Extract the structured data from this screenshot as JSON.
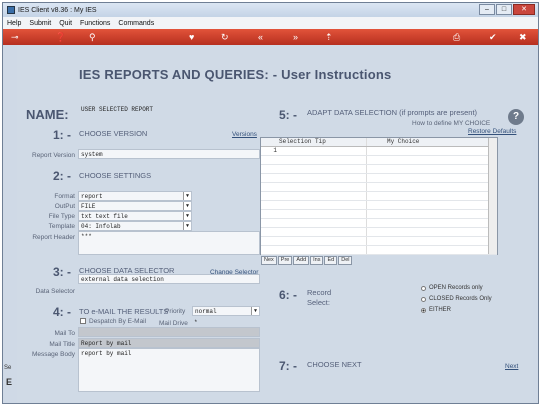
{
  "window": {
    "title": "IES Client v8.36 : My IES",
    "controls": [
      "–",
      "□",
      "✕"
    ]
  },
  "menu": {
    "items": [
      "Help",
      "Submit",
      "Quit",
      "Functions",
      "Commands"
    ]
  },
  "toolbar": {
    "icons": [
      "key-icon",
      "help-icon",
      "search-icon",
      "heart-icon",
      "refresh-icon",
      "first-icon",
      "last-icon",
      "up-icon",
      "print-icon",
      "accept-icon",
      "cancel-icon"
    ]
  },
  "page": {
    "heading": "IES REPORTS AND QUERIES: -   User Instructions",
    "name_label": "NAME:",
    "name_value": "USER SELECTED REPORT",
    "sections": {
      "s1": {
        "num": "1: -",
        "title": "CHOOSE VERSION",
        "link": "Versions",
        "report_version_label": "Report Version",
        "report_version_value": "system"
      },
      "s2": {
        "num": "2: -",
        "title": "CHOOSE SETTINGS",
        "format_label": "Format",
        "format_value": "report",
        "output_label": "OutPut",
        "output_value": "FILE",
        "filetype_label": "File Type",
        "filetype_value": "txt text file",
        "template_label": "Template",
        "template_value": "04: Infolab",
        "header_label": "Report Header",
        "header_value": "***"
      },
      "s3": {
        "num": "3: -",
        "title": "CHOOSE DATA SELECTOR",
        "link": "Change Selector",
        "selector_value": "external data selection",
        "data_selector_label": "Data Selector"
      },
      "s4": {
        "num": "4: -",
        "title": "TO e-MAIL THE RESULTS",
        "priority_label": "Priority",
        "priority_value": "normal",
        "despatch_label": "Despatch By E-Mail",
        "mail_drive_label": "Mail Drive",
        "mail_drive_value": "*",
        "mail_to_label": "Mail To",
        "mail_title_label": "Mail Title",
        "mail_title_value": "Report by mail",
        "mail_body_label": "Message Body",
        "mail_body_value": "report by mail"
      },
      "s5": {
        "num": "5: -",
        "title": "ADAPT DATA SELECTION (if prompts are present)",
        "howto": "How to define MY CHOICE",
        "restore": "Restore Defaults",
        "columns": [
          "Selection Tip",
          "My Choice"
        ],
        "row_number": "1",
        "grid_buttons": [
          "Nex",
          "Pre",
          "Add",
          "Ins",
          "Ed",
          "Del"
        ]
      },
      "s6": {
        "num": "6: -",
        "title": "Record",
        "title2": "Select:",
        "options": [
          "OPEN Records only",
          "CLOSED Records Only",
          "EITHER"
        ],
        "selected": "EITHER"
      },
      "s7": {
        "num": "7: -",
        "title": "CHOOSE NEXT",
        "link": "Next"
      }
    },
    "sidebar_text": [
      "Se",
      "E"
    ]
  },
  "colors": {
    "toolbar": "#c23a26",
    "heading": "#4a5670",
    "background": "#d0dae6"
  }
}
